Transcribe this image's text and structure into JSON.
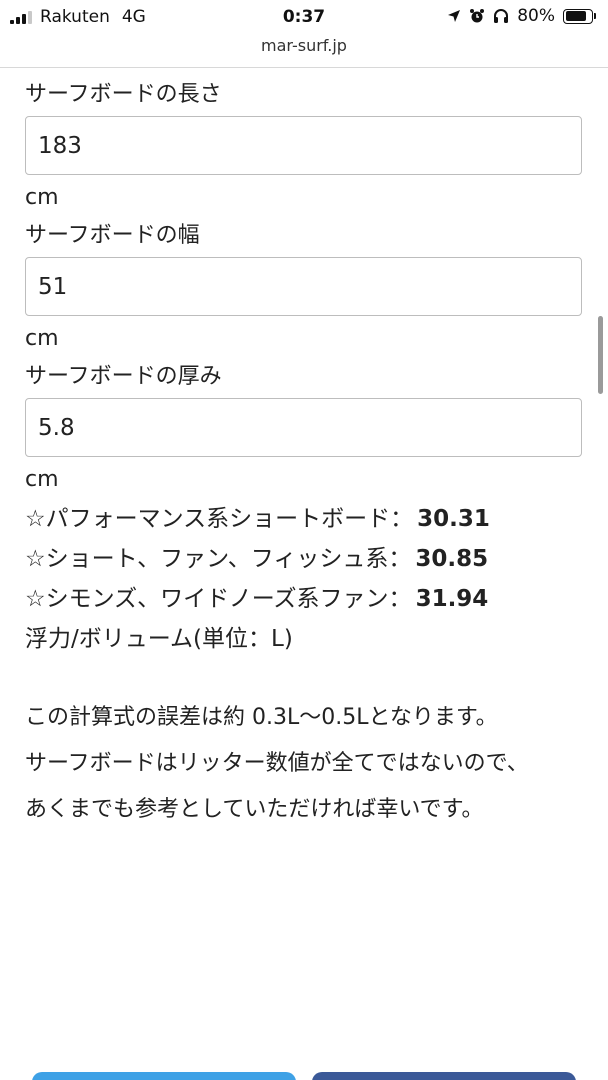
{
  "status_bar": {
    "carrier": "Rakuten",
    "network": "4G",
    "time": "0:37",
    "battery_text": "80%",
    "battery_level": 0.8,
    "icons": [
      "signal-icon",
      "location-arrow-icon",
      "alarm-icon",
      "headphones-icon",
      "battery-icon"
    ]
  },
  "browser": {
    "url": "mar-surf.jp"
  },
  "form": {
    "length": {
      "label": "サーフボードの長さ",
      "value": "183",
      "unit": "cm"
    },
    "width": {
      "label": "サーフボードの幅",
      "value": "51",
      "unit": "cm"
    },
    "thickness": {
      "label": "サーフボードの厚み",
      "value": "5.8",
      "unit": "cm"
    }
  },
  "results": [
    {
      "label": "☆パフォーマンス系ショートボード：",
      "value": "30.31"
    },
    {
      "label": "☆ショート、ファン、フィッシュ系：",
      "value": "30.85"
    },
    {
      "label": "☆シモンズ、ワイドノーズ系ファン：",
      "value": "31.94"
    }
  ],
  "unit_note": "浮力/ボリューム(単位：L)",
  "notes": [
    "この計算式の誤差は約 0.3L〜0.5Lとなります。",
    "サーフボードはリッター数値が全てではないので、",
    "あくまでも参考としていただければ幸いです。"
  ],
  "colors": {
    "share_button_1": "#3ea1e6",
    "share_button_2": "#3b5998"
  }
}
